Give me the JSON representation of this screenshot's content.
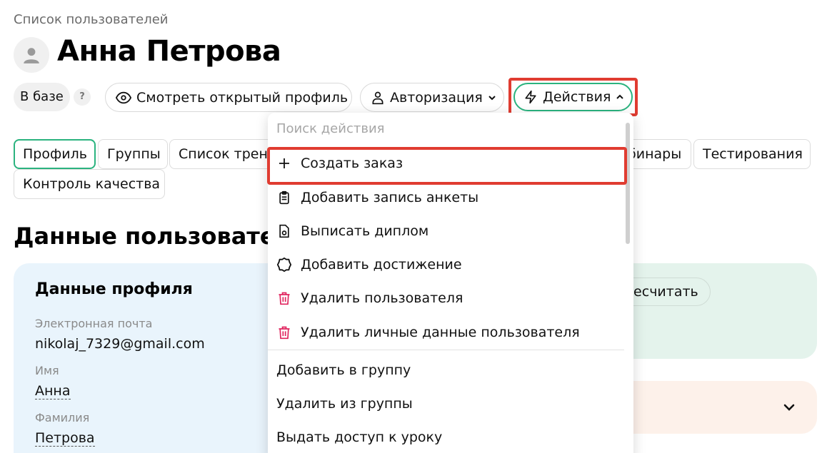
{
  "breadcrumb": "Список пользователей",
  "page_title": "Анна Петрова",
  "status_badge": "В базе",
  "help_icon": "?",
  "header_buttons": {
    "open_profile": "Смотреть открытый профиль",
    "authorization": "Авторизация",
    "actions": "Действия"
  },
  "tabs": [
    "Профиль",
    "Группы",
    "Список трен",
    "бинары",
    "Тестирования",
    "Контроль качества"
  ],
  "section_title": "Данные пользовател",
  "profile_card": {
    "title": "Данные профиля",
    "email_label": "Электронная почта",
    "email_value": "nikolaj_7329@gmail.com",
    "first_name_label": "Имя",
    "first_name_value": "Анна",
    "last_name_label": "Фамилия",
    "last_name_value": "Петрова"
  },
  "recalc_button": "ресчитать",
  "actions_menu": {
    "search_placeholder": "Поиск действия",
    "items": [
      {
        "label": "Создать заказ",
        "icon": "plus-icon"
      },
      {
        "label": "Добавить запись анкеты",
        "icon": "clipboard-icon"
      },
      {
        "label": "Выписать диплом",
        "icon": "diploma-icon"
      },
      {
        "label": "Добавить достижение",
        "icon": "badge-icon"
      },
      {
        "label": "Удалить пользователя",
        "icon": "trash-icon"
      },
      {
        "label": "Удалить личные данные пользователя",
        "icon": "trash-icon"
      }
    ],
    "group_items": [
      "Добавить в группу",
      "Удалить из группы",
      "Выдать доступ к уроку"
    ]
  },
  "colors": {
    "accent": "#2bb37f",
    "highlight": "#e03c31",
    "danger_icon": "#e0245e",
    "profile_card_bg": "#e9f4fc",
    "green_card_bg": "#e4f3ec",
    "peach_card_bg": "#fdf1ea"
  }
}
